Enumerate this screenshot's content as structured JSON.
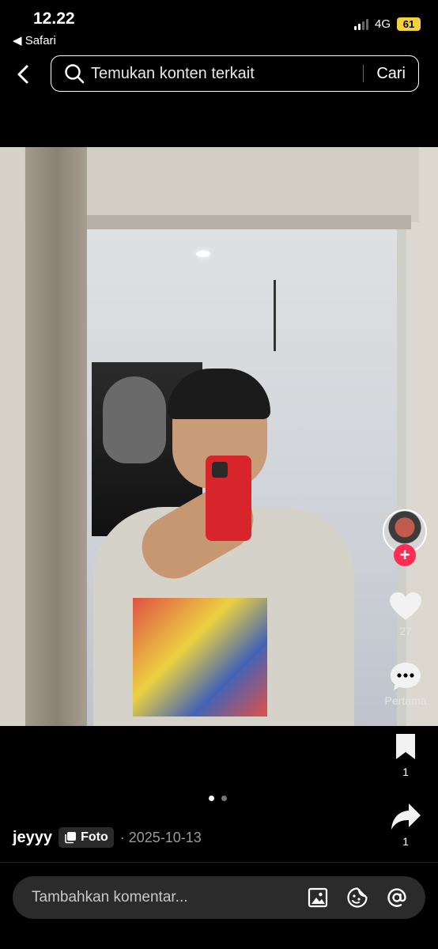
{
  "status_bar": {
    "time": "12.22",
    "back_app": "◀ Safari",
    "network": "4G",
    "battery": "61"
  },
  "search": {
    "placeholder": "Temukan konten terkait",
    "button": "Cari"
  },
  "post": {
    "author": "jeyyy",
    "type_label": "Foto",
    "date": "· 2025-10-13",
    "carousel_dots": 2,
    "active_dot": 0
  },
  "actions": {
    "likes": "27",
    "comments": "Pertama",
    "saves": "1",
    "shares": "1"
  },
  "comment_bar": {
    "placeholder": "Tambahkan komentar..."
  },
  "colors": {
    "accent": "#fe2c55",
    "battery": "#f3d03e"
  }
}
